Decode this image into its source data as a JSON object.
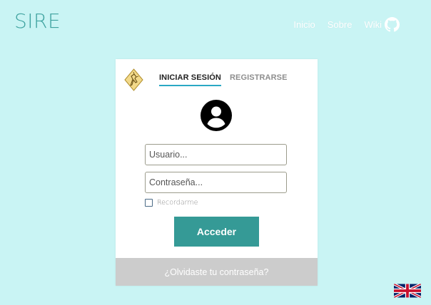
{
  "header": {
    "brand": "SIRE",
    "nav": [
      {
        "label": "Inicio"
      },
      {
        "label": "Sobre"
      },
      {
        "label": "Wiki",
        "icon": "github-icon"
      }
    ]
  },
  "login": {
    "logo_icon": "organization-logo",
    "tabs": [
      {
        "label": "INICIAR SESIÓN",
        "active": true
      },
      {
        "label": "REGISTRARSE",
        "active": false
      }
    ],
    "user_icon": "account-circle-icon",
    "username_placeholder": "Usuario...",
    "username_value": "",
    "password_placeholder": "Contraseña...",
    "password_value": "",
    "remember_label": "Recordarme",
    "remember_checked": false,
    "submit_label": "Acceder",
    "forgot_label": "¿Olvidaste tu contraseña?"
  },
  "language": {
    "flag_icon": "uk-flag-icon"
  },
  "colors": {
    "background": "#c9f4f4",
    "brand": "#3fa3a0",
    "button": "#359a96",
    "tab_underline": "#2aa8c4",
    "forgot_bar": "#cccccc"
  }
}
